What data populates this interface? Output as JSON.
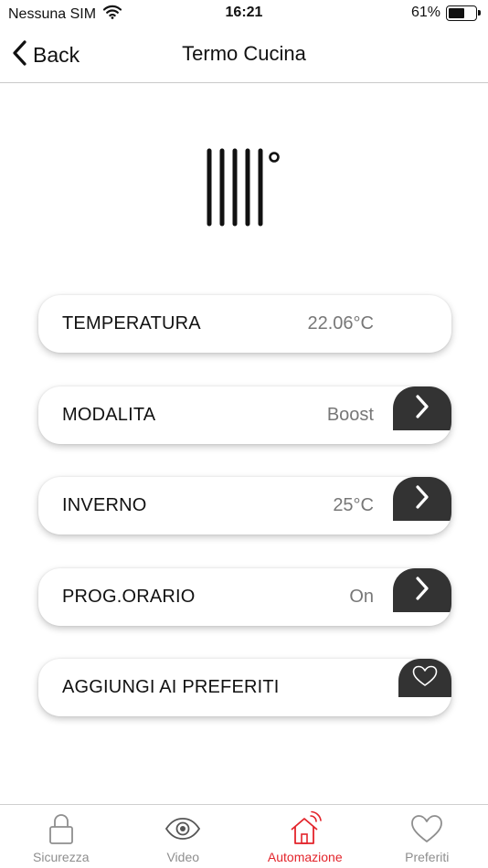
{
  "status_bar": {
    "carrier": "Nessuna SIM",
    "time": "16:21",
    "battery": "61%",
    "battery_level": 0.61
  },
  "nav": {
    "back_label": "Back",
    "title": "Termo Cucina"
  },
  "device": {
    "icon": "radiator-icon"
  },
  "rows": [
    {
      "label": "TEMPERATURA",
      "value": "22.06°C",
      "action": null
    },
    {
      "label": "MODALITA",
      "value": "Boost",
      "action": "chevron-right-icon"
    },
    {
      "label": "INVERNO",
      "value": "25°C",
      "action": "chevron-right-icon"
    },
    {
      "label": "PROG.ORARIO",
      "value": "On",
      "action": "chevron-right-icon"
    },
    {
      "label": "AGGIUNGI AI PREFERITI",
      "value": "",
      "action": "heart-icon"
    }
  ],
  "tabs": [
    {
      "label": "Sicurezza",
      "icon": "lock-icon",
      "active": false
    },
    {
      "label": "Video",
      "icon": "eye-icon",
      "active": false
    },
    {
      "label": "Automazione",
      "icon": "home-wifi-icon",
      "active": true
    },
    {
      "label": "Preferiti",
      "icon": "heart-icon",
      "active": false
    }
  ],
  "colors": {
    "accent": "#e3242b",
    "action_bg": "#333333",
    "value_text": "#777777",
    "inactive_tab": "#8e8e8e"
  }
}
